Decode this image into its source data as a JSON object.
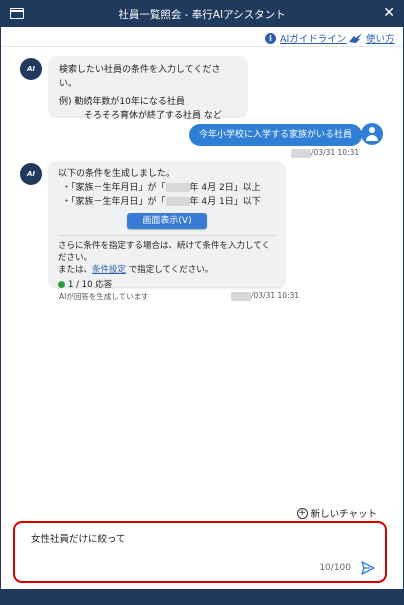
{
  "window": {
    "title": "社員一覧照会 - 奉行AIアシスタント",
    "close_glyph": "✕"
  },
  "toolbar": {
    "guideline_label": "AIガイドライン",
    "howto_label": "使い方"
  },
  "messages": {
    "ai1": {
      "avatar": "AI",
      "line1": "検索したい社員の条件を入力してください。",
      "line2": "例)  勤続年数が10年になる社員",
      "line3": "そろそろ育休が終了する社員 など"
    },
    "user1": {
      "text": "今年小学校に入学する家族がいる社員",
      "timestamp": "/03/31 10:31"
    },
    "ai2": {
      "avatar": "AI",
      "intro": "以下の条件を生成しました。",
      "cond1_a": "・「家族－生年月日」が「",
      "cond1_b": "年 4月 2日」以上",
      "cond2_a": "・「家族－生年月日」が「",
      "cond2_b": "年 4月 1日」以下",
      "view_button": "画面表示(V)",
      "note1": "さらに条件を指定する場合は、続けて条件を入力してください。",
      "note2_a": "または、",
      "note2_link": "条件設定",
      "note2_b": " で指定してください。",
      "count": "1 / 10 応答",
      "generated_label": "AIが回答を生成しています",
      "timestamp": "/03/31 10:31"
    }
  },
  "new_chat_label": "新しいチャット",
  "input": {
    "value": "女性社員だけに絞って",
    "char_count": "10/100"
  },
  "colors": {
    "titlebar": "#1f3a5c",
    "accent": "#2f7fd6",
    "highlight_border": "#d40000"
  },
  "icons": [
    "window-icon",
    "close-icon",
    "info-icon",
    "bird-icon",
    "ai-avatar-icon",
    "user-avatar-icon",
    "plus-circle-icon",
    "send-icon",
    "status-dot-icon"
  ]
}
